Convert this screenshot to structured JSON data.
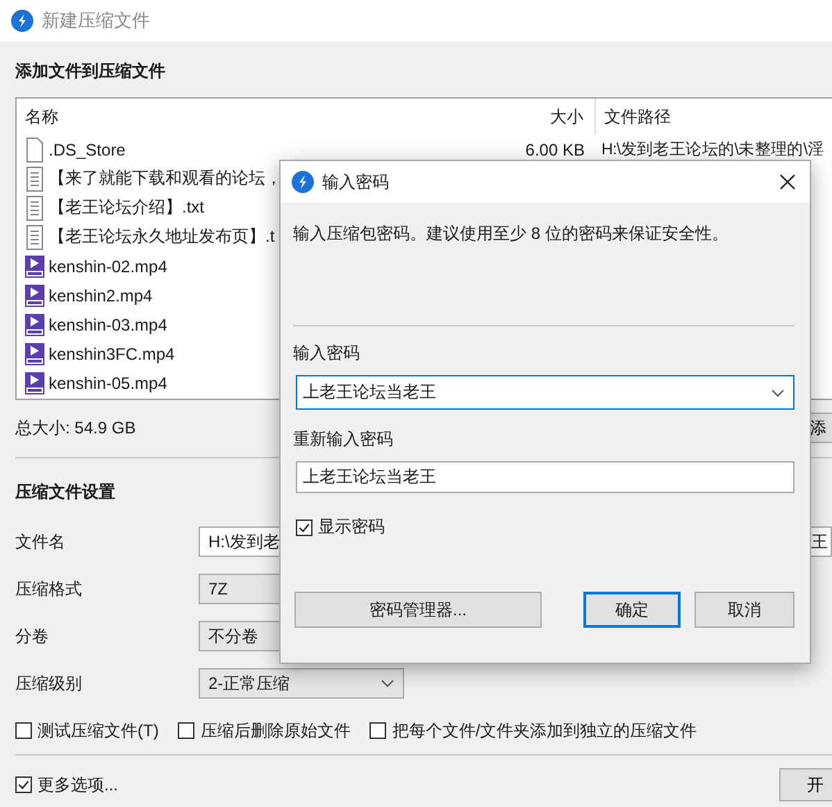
{
  "window": {
    "title": "新建压缩文件"
  },
  "add_section": {
    "heading": "添加文件到压缩文件"
  },
  "file_list": {
    "columns": [
      "名称",
      "大小",
      "文件路径"
    ],
    "rows": [
      {
        "kind": "blank",
        "name": ".DS_Store",
        "size": "6.00 KB",
        "path": "H:\\发到老王论坛的\\未整理的\\淫"
      },
      {
        "kind": "text",
        "name": "【来了就能下载和观看的论坛，"
      },
      {
        "kind": "text",
        "name": "【老王论坛介绍】.txt"
      },
      {
        "kind": "text",
        "name": "【老王论坛永久地址发布页】.t"
      },
      {
        "kind": "video",
        "name": "kenshin-02.mp4"
      },
      {
        "kind": "video",
        "name": "kenshin2.mp4"
      },
      {
        "kind": "video",
        "name": "kenshin-03.mp4"
      },
      {
        "kind": "video",
        "name": "kenshin3FC.mp4"
      },
      {
        "kind": "video",
        "name": "kenshin-05.mp4"
      }
    ]
  },
  "total_size": "总大小: 54.9 GB",
  "add_button": "添",
  "settings": {
    "heading": "压缩文件设置",
    "fields": [
      {
        "kind": "text",
        "label": "文件名",
        "value": "H:\\发到老",
        "value_end": "王"
      },
      {
        "kind": "select",
        "label": "压缩格式",
        "value": "7Z"
      },
      {
        "kind": "select",
        "label": "分卷",
        "value": "不分卷"
      },
      {
        "kind": "dropdown",
        "label": "压缩级别",
        "value": "2-正常压缩"
      }
    ]
  },
  "options": [
    {
      "label": "测试压缩文件(T)",
      "checked": false
    },
    {
      "label": "压缩后删除原始文件",
      "checked": false
    },
    {
      "label": "把每个文件/文件夹添加到独立的压缩文件",
      "checked": false
    }
  ],
  "more_options": {
    "label": "更多选项...",
    "checked": true
  },
  "start_button": "开",
  "dialog": {
    "title": "输入密码",
    "description": "输入压缩包密码。建议使用至少 8 位的密码来保证安全性。",
    "password_label": "输入密码",
    "password": "上老王论坛当老王",
    "confirm_label": "重新输入密码",
    "confirm": "上老王论坛当老王",
    "show_password": {
      "label": "显示密码",
      "checked": true
    },
    "buttons": [
      {
        "label": "密码管理器...",
        "default": false
      },
      {
        "label": "确定",
        "default": true
      },
      {
        "label": "取消",
        "default": false
      }
    ]
  }
}
